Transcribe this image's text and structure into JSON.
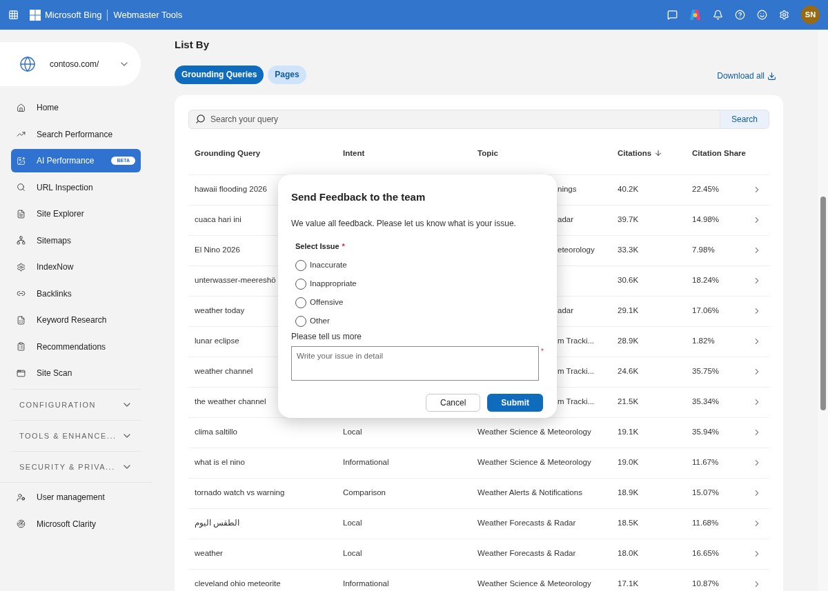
{
  "topbar": {
    "brand": "Microsoft Bing",
    "product": "Webmaster Tools",
    "avatar": "SN"
  },
  "sidebar": {
    "site": "contoso.com/",
    "items": [
      {
        "label": "Home",
        "selected": false
      },
      {
        "label": "Search Performance",
        "selected": false
      },
      {
        "label": "AI Performance",
        "selected": true,
        "badge": "BETA"
      },
      {
        "label": "URL Inspection",
        "selected": false
      },
      {
        "label": "Site Explorer",
        "selected": false
      },
      {
        "label": "Sitemaps",
        "selected": false
      },
      {
        "label": "IndexNow",
        "selected": false
      },
      {
        "label": "Backlinks",
        "selected": false
      },
      {
        "label": "Keyword Research",
        "selected": false
      },
      {
        "label": "Recommendations",
        "selected": false
      },
      {
        "label": "Site Scan",
        "selected": false
      }
    ],
    "sections": [
      {
        "label": "CONFIGURATION",
        "expanded": false
      },
      {
        "label": "TOOLS & ENHANCE...",
        "expanded": false
      },
      {
        "label": "SECURITY & PRIVA...",
        "expanded": false
      }
    ],
    "bottom_items": [
      {
        "label": "User management",
        "selected": false
      },
      {
        "label": "Microsoft Clarity",
        "selected": false
      }
    ]
  },
  "main": {
    "heading": "List By",
    "tabs": [
      {
        "label": "Grounding Queries",
        "selected": true
      },
      {
        "label": "Pages",
        "selected": false
      }
    ],
    "download": "Download all",
    "search": {
      "placeholder": "Search your query",
      "button": "Search"
    },
    "table": {
      "columns": [
        {
          "label": "Grounding Query",
          "sorted_descending": false
        },
        {
          "label": "Intent",
          "sorted_descending": false
        },
        {
          "label": "Topic",
          "sorted_descending": false
        },
        {
          "label": "Citations",
          "sorted_descending": true
        },
        {
          "label": "Citation Share",
          "sorted_descending": false
        }
      ],
      "rows": [
        {
          "kind": "covered",
          "query": "hawaii flooding 2026",
          "topic": "nings",
          "citations": "40.2K",
          "share": "22.45%"
        },
        {
          "kind": "covered",
          "query": "cuaca hari ini",
          "topic": "adar",
          "citations": "39.7K",
          "share": "14.98%"
        },
        {
          "kind": "covered",
          "query": "El Nino 2026",
          "topic": "eteorology",
          "citations": "33.3K",
          "share": "7.98%"
        },
        {
          "kind": "covered",
          "query": "unterwasser-meereshö",
          "citations": "30.6K",
          "share": "18.24%"
        },
        {
          "kind": "covered",
          "query": "weather today",
          "topic": "adar",
          "citations": "29.1K",
          "share": "17.06%"
        },
        {
          "kind": "covered",
          "query": "lunar eclipse",
          "topic": "m Tracki...",
          "citations": "28.9K",
          "share": "1.82%"
        },
        {
          "kind": "covered",
          "query": "weather channel",
          "topic": "m Tracki...",
          "citations": "24.6K",
          "share": "35.75%"
        },
        {
          "kind": "covered",
          "query": "the weather channel",
          "topic": "m Tracki...",
          "citations": "21.5K",
          "share": "35.34%"
        },
        {
          "kind": "full",
          "query": "clima saltillo",
          "intent": "Local",
          "topic": "Weather Science & Meteorology",
          "citations": "19.1K",
          "share": "35.94%"
        },
        {
          "kind": "full",
          "query": "what is el nino",
          "intent": "Informational",
          "topic": "Weather Science & Meteorology",
          "citations": "19.0K",
          "share": "11.67%"
        },
        {
          "kind": "full",
          "query": "tornado watch vs warning",
          "intent": "Comparison",
          "topic": "Weather Alerts & Notifications",
          "citations": "18.9K",
          "share": "15.07%"
        },
        {
          "kind": "full",
          "query": "الطقس اليوم",
          "intent": "Local",
          "topic": "Weather Forecasts & Radar",
          "citations": "18.5K",
          "share": "11.68%"
        },
        {
          "kind": "full",
          "query": "weather",
          "intent": "Local",
          "topic": "Weather Forecasts & Radar",
          "citations": "18.0K",
          "share": "16.65%"
        },
        {
          "kind": "full",
          "query": "cleveland ohio meteorite",
          "intent": "Informational",
          "topic": "Weather Science & Meteorology",
          "citations": "17.1K",
          "share": "10.87%"
        }
      ]
    }
  },
  "dialog": {
    "title": "Send Feedback to the team",
    "message": "We value all feedback. Please let us know what is your issue.",
    "issue_label": "Select Issue",
    "issue_required_mark": "*",
    "options": [
      {
        "label": "Inaccurate",
        "selected": false
      },
      {
        "label": "Inappropriate",
        "selected": false
      },
      {
        "label": "Offensive",
        "selected": false
      },
      {
        "label": "Other",
        "selected": false
      }
    ],
    "detail_label": "Please tell us more",
    "detail_placeholder": "Write your issue in detail",
    "detail_required_mark": "*",
    "buttons": [
      {
        "label": "Cancel",
        "kind": "secondary"
      },
      {
        "label": "Submit",
        "kind": "primary"
      }
    ]
  }
}
